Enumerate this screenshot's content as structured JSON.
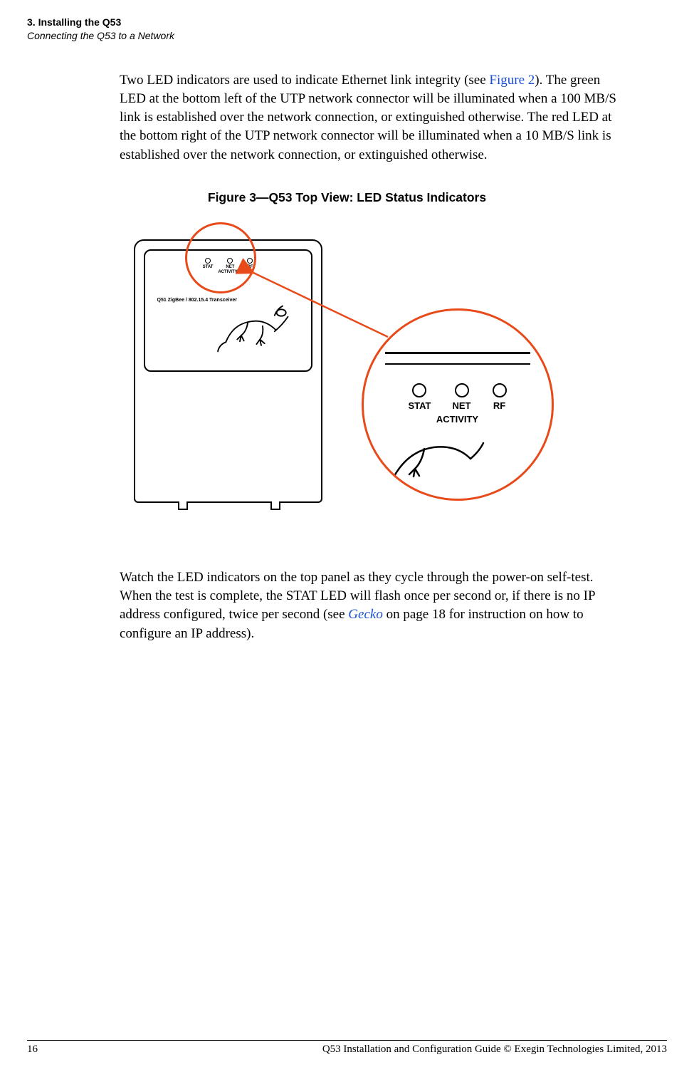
{
  "header": {
    "line1": "3. Installing the Q53",
    "line2": "Connecting the Q53 to a Network"
  },
  "para1_prefix": "Two LED indicators are used to indicate Ethernet link integrity (see ",
  "figure2_link": "Figure 2",
  "para1_suffix": "). The green LED at the bottom left of the UTP network connector will be illuminated when a 100 MB/S link is established over the network connection, or extinguished otherwise. The red LED at the bottom right of the UTP network connector will be illuminated when a 10 MB/S link is established over the network connection, or extinguished otherwise.",
  "figure_caption": "Figure 3—Q53 Top View: LED Status Indicators",
  "leds": {
    "stat": "STAT",
    "net": "NET",
    "rf": "RF",
    "activity": "ACTIVITY"
  },
  "device_label": "Q51 ZigBee / 802.15.4 Transceiver",
  "para2_prefix": "Watch the LED indicators on the top panel as they cycle through the power-on self-test. When the test is complete, the STAT LED will flash once per second or, if there is no IP address configured, twice per second (see ",
  "gecko_link": "Gecko",
  "para2_mid": " on page 18 for instruction on how to configure an IP address).",
  "footer": {
    "page": "16",
    "text": "Q53 Installation and Configuration Guide  © Exegin Technologies Limited, 2013"
  }
}
